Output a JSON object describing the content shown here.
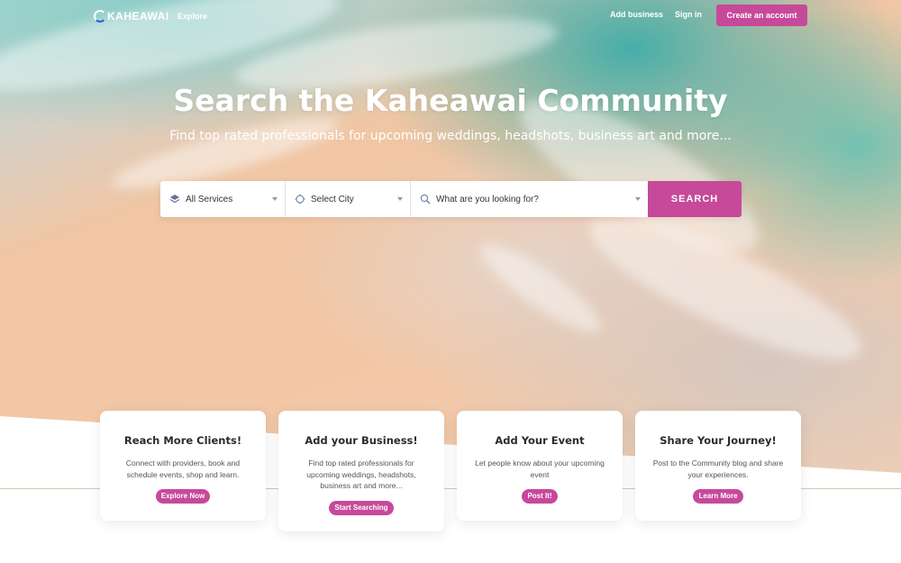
{
  "header": {
    "logo_text": "KAHEAWAI",
    "explore": "Explore",
    "add_business": "Add business",
    "sign_in": "Sign in",
    "create_account": "Create an account"
  },
  "hero": {
    "title": "Search the Kaheawai Community",
    "subtitle": "Find top rated professionals for upcoming weddings, headshots, business art and more..."
  },
  "search": {
    "services_value": "All Services",
    "city_value": "Select City",
    "query_placeholder": "What are you looking for?",
    "button": "SEARCH"
  },
  "cards": [
    {
      "title": "Reach More Clients!",
      "text": "Connect with providers, book and schedule events, shop and learn.",
      "button": "Explore Now"
    },
    {
      "title": "Add your Business!",
      "text": "Find top rated professionals for upcoming weddings, headshots, business art and more...",
      "button": "Start Searching"
    },
    {
      "title": "Add Your Event",
      "text": "Let people know about your upcoming event",
      "button": "Post It!"
    },
    {
      "title": "Share Your Journey!",
      "text": "Post to the Community blog and share your experiences.",
      "button": "Learn More"
    }
  ],
  "colors": {
    "accent": "#c7499a",
    "white": "#ffffff"
  },
  "icons": {
    "services": "layers-icon",
    "city": "location-icon",
    "query": "search-icon"
  }
}
